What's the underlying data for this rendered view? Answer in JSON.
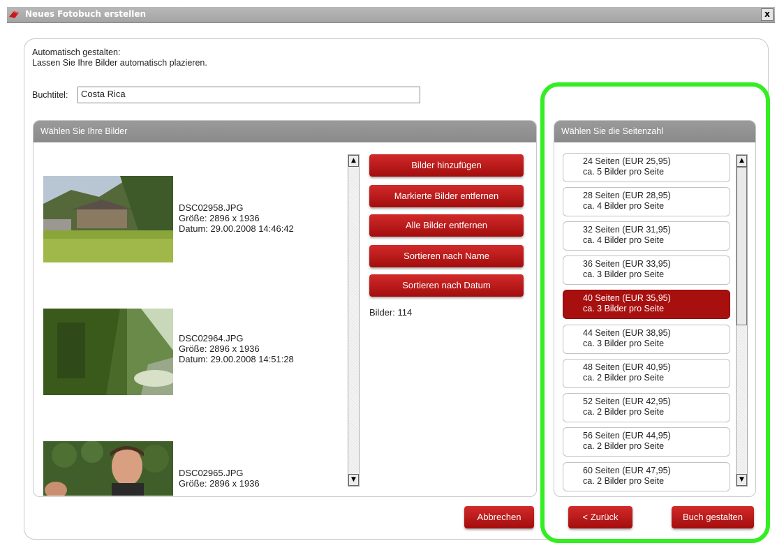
{
  "window": {
    "title": "Neues Fotobuch erstellen",
    "close_glyph": "x"
  },
  "intro": {
    "line1": "Automatisch gestalten:",
    "line2": "Lassen Sie Ihre Bilder automatisch plazieren."
  },
  "buchtitel": {
    "label": "Buchtitel:",
    "value": "Costa Rica"
  },
  "images_panel": {
    "header": "Wählen Sie Ihre Bilder",
    "items": [
      {
        "filename": "DSC02958.JPG",
        "size": "Größe: 2896 x 1936",
        "date": "Datum: 29.00.2008 14:46:42"
      },
      {
        "filename": "DSC02964.JPG",
        "size": "Größe: 2896 x 1936",
        "date": "Datum: 29.00.2008 14:51:28"
      },
      {
        "filename": "DSC02965.JPG",
        "size": "Größe: 2896 x 1936",
        "date": ""
      }
    ],
    "buttons": {
      "add": "Bilder hinzufügen",
      "remove_marked": "Markierte Bilder entfernen",
      "remove_all": "Alle Bilder entfernen",
      "sort_name": "Sortieren nach Name",
      "sort_date": "Sortieren nach Datum"
    },
    "count_text": "Bilder: 114"
  },
  "pages_panel": {
    "header": "Wählen Sie die Seitenzahl",
    "selected_value": "40 Seiten (EUR 35,95)",
    "options": [
      {
        "pages": "24 Seiten (EUR 25,95)",
        "per_page": "ca. 5 Bilder pro Seite"
      },
      {
        "pages": "28 Seiten (EUR 28,95)",
        "per_page": "ca. 4 Bilder pro Seite"
      },
      {
        "pages": "32 Seiten (EUR 31,95)",
        "per_page": "ca. 4 Bilder pro Seite"
      },
      {
        "pages": "36 Seiten (EUR 33,95)",
        "per_page": "ca. 3 Bilder pro Seite"
      },
      {
        "pages": "40 Seiten (EUR 35,95)",
        "per_page": "ca. 3 Bilder pro Seite"
      },
      {
        "pages": "44 Seiten (EUR 38,95)",
        "per_page": "ca. 3 Bilder pro Seite"
      },
      {
        "pages": "48 Seiten (EUR 40,95)",
        "per_page": "ca. 2 Bilder pro Seite"
      },
      {
        "pages": "52 Seiten (EUR 42,95)",
        "per_page": "ca. 2 Bilder pro Seite"
      },
      {
        "pages": "56 Seiten (EUR 44,95)",
        "per_page": "ca. 2 Bilder pro Seite"
      },
      {
        "pages": "60 Seiten (EUR 47,95)",
        "per_page": "ca. 2 Bilder pro Seite"
      }
    ]
  },
  "footer": {
    "cancel": "Abbrechen",
    "back": "< Zurück",
    "create": "Buch gestalten"
  },
  "colors": {
    "accent_red": "#b01414",
    "selected_red": "#a8100f",
    "highlight_green": "#33ee22",
    "panel_header_gray": "#929292"
  }
}
